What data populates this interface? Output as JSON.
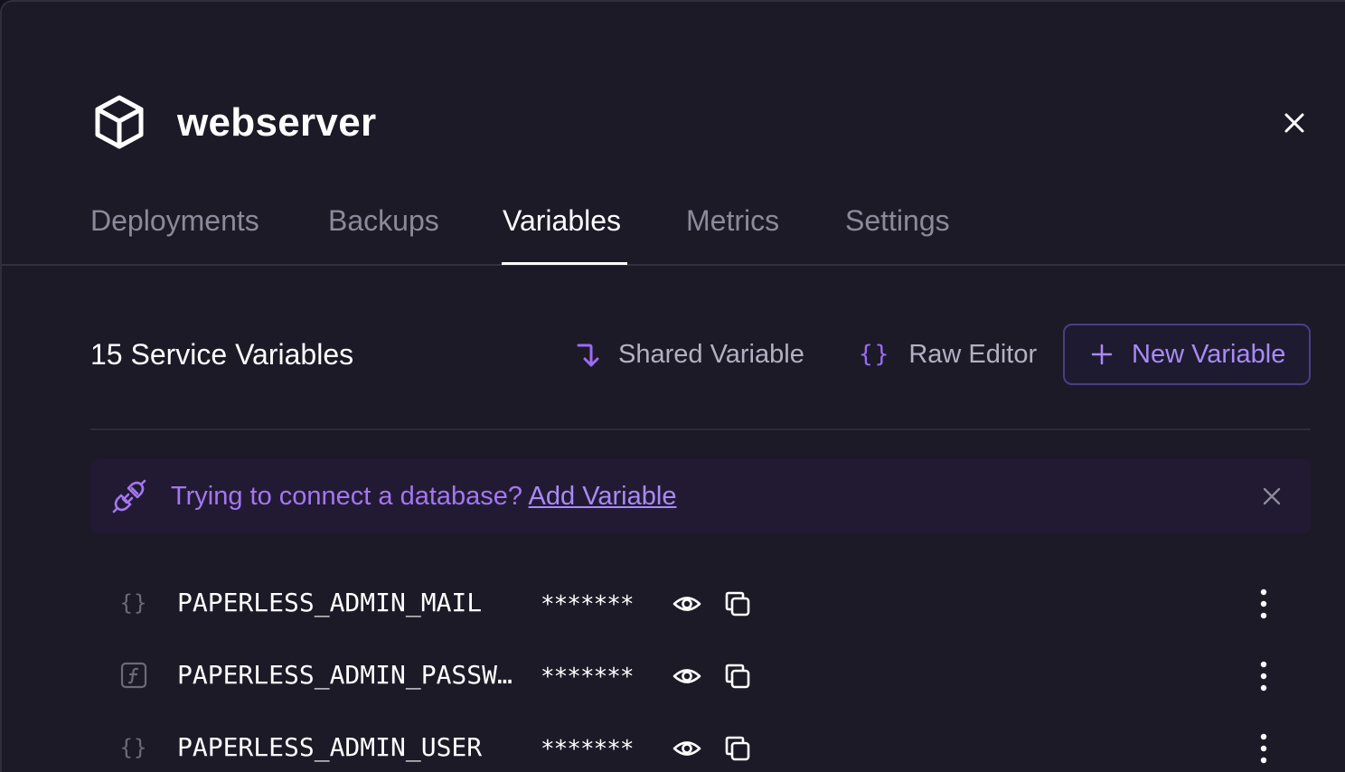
{
  "service": {
    "name": "webserver",
    "icon": "cube-icon"
  },
  "tabs": [
    {
      "label": "Deployments",
      "active": false
    },
    {
      "label": "Backups",
      "active": false
    },
    {
      "label": "Variables",
      "active": true
    },
    {
      "label": "Metrics",
      "active": false
    },
    {
      "label": "Settings",
      "active": false
    }
  ],
  "toolbar": {
    "count_label": "15 Service Variables",
    "shared_variable_label": "Shared Variable",
    "raw_editor_label": "Raw Editor",
    "raw_editor_icon_text": "{}",
    "new_variable_label": "New Variable"
  },
  "banner": {
    "text": "Trying to connect a database?",
    "link": "Add Variable"
  },
  "variables": [
    {
      "type_icon": "braces-icon",
      "type_glyph": "{}",
      "name": "PAPERLESS_ADMIN_MAIL",
      "value": "*******"
    },
    {
      "type_icon": "function-icon",
      "type_glyph": "",
      "name": "PAPERLESS_ADMIN_PASSW…",
      "value": "*******"
    },
    {
      "type_icon": "braces-icon",
      "type_glyph": "{}",
      "name": "PAPERLESS_ADMIN_USER",
      "value": "*******"
    }
  ],
  "colors": {
    "background": "#1c1a27",
    "accent": "#9b6cf5",
    "banner_text": "#a377f0",
    "text_primary": "#ffffff",
    "text_muted": "#8c8a9a"
  }
}
